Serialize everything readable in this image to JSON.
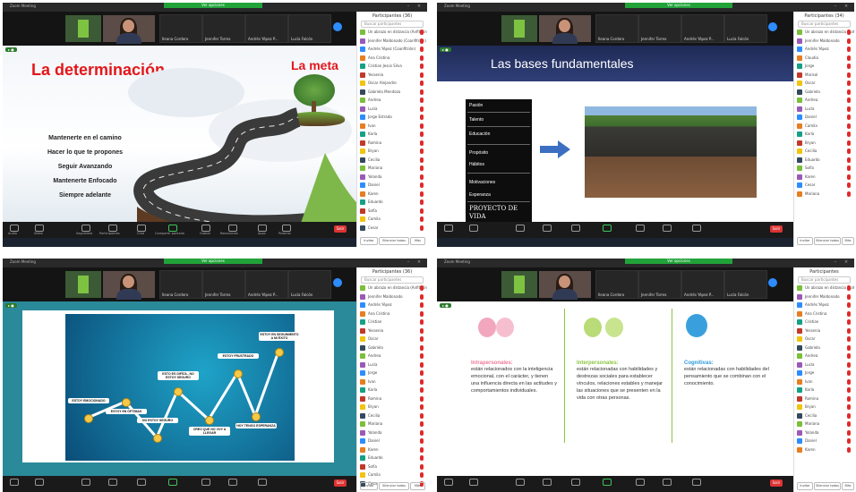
{
  "panes": [
    {
      "window_title": "Zoom Meeting",
      "participants_title": "Participantes (36)",
      "search_placeholder": "Buscar participantes",
      "participant_names": [
        "Un abrazo en distancia (Anfitrión, yo)",
        "Jennifer Maldonado (Coanfitrión)",
        "Andrés Yépez (Coanfitrión)",
        "Ana Cristina",
        "Cristian Jesús Silva",
        "Yessenia",
        "Oscar Alejandro",
        "Gabriela Mendoza",
        "Andrea",
        "Lucía",
        "Jorge Estrada",
        "Ivan",
        "Karla",
        "Romina",
        "Bryan",
        "Cecilia",
        "Mariana",
        "Yolanda",
        "Daniel",
        "Karen",
        "Eduardo",
        "Sofía",
        "Camila",
        "Cesar"
      ],
      "footer_buttons": [
        "Invitar",
        "Silenciar todos",
        "Más"
      ],
      "slide": {
        "title": "La determinación",
        "goal_label": "La meta",
        "items": [
          "Mantenerte en el camino",
          "Hacer lo que te propones",
          "Seguir Avanzando",
          "Mantenerte Enfocado",
          "Siempre adelante"
        ]
      }
    },
    {
      "window_title": "Zoom Meeting",
      "participants_title": "Participantes (34)",
      "search_placeholder": "Buscar participantes",
      "participant_names": [
        "Un abrazo en distancia (Anfitrión, yo)",
        "Jennifer Maldonado",
        "Andrés Yépez",
        "Claudia",
        "Jorge",
        "Marisol",
        "Oscar",
        "Gabriela",
        "Andrea",
        "Lucía",
        "Daniel",
        "Camila",
        "Karla",
        "Bryan",
        "Cecilia",
        "Eduardo",
        "Sofía",
        "Karen",
        "Cesar",
        "Mariana"
      ],
      "footer_buttons": [
        "Invitar",
        "Silenciar todos",
        "Más"
      ],
      "slide": {
        "title": "Las bases fundamentales",
        "bases": [
          "Pasión",
          "Talento",
          "Educación",
          "Propósito",
          "Hábitos",
          "Motivaciones",
          "Esperanza"
        ],
        "footer": "PROYECTO DE VIDA"
      }
    },
    {
      "window_title": "Zoom Meeting",
      "participants_title": "Participantes (36)",
      "search_placeholder": "Buscar participantes",
      "participant_names": [
        "Un abrazo en distancia (Anfitrión, yo)",
        "Jennifer Maldonado",
        "Andrés Yépez",
        "Ana Cristina",
        "Cristian",
        "Yessenia",
        "Oscar",
        "Gabriela",
        "Andrea",
        "Lucía",
        "Jorge",
        "Ivan",
        "Karla",
        "Romina",
        "Bryan",
        "Cecilia",
        "Mariana",
        "Yolanda",
        "Daniel",
        "Karen",
        "Eduardo",
        "Sofía",
        "Camila",
        "Cesar"
      ],
      "footer_buttons": [
        "Invitar",
        "Silenciar todos",
        "Más"
      ],
      "slide": {
        "nodes": [
          "ESTOY EMOCIONADO",
          "ESTOY EN ÓPTIMAS",
          "NO ESTOY SEGURO",
          "ESTO ES DIFÍCIL, NO ESTOY SEGURO",
          "ESTOY FRUSTRADO",
          "CREO QUE NO VOY A LLEGAR",
          "HOY TENGO ESPERANZA",
          "HOY ALGO SALE BIEN",
          "ESTOY EN SEGUIMIENTO A MI ÉXITO"
        ]
      }
    },
    {
      "window_title": "Zoom Meeting",
      "participants_title": "Participantes",
      "search_placeholder": "Buscar participantes",
      "participant_names": [
        "Un abrazo en distancia (Anfitrión, yo)",
        "Jennifer Maldonado",
        "Andrés Yépez",
        "Ana Cristina",
        "Cristian",
        "Yessenia",
        "Oscar",
        "Gabriela",
        "Andrea",
        "Lucía",
        "Jorge",
        "Ivan",
        "Karla",
        "Romina",
        "Bryan",
        "Cecilia",
        "Mariana",
        "Yolanda",
        "Daniel",
        "Karen"
      ],
      "footer_buttons": [
        "Invitar",
        "Silenciar todos",
        "Más"
      ],
      "slide": {
        "columns": [
          {
            "title": "Intrapersonales:",
            "body": "están relacionados con la inteligencia emocional, con el carácter, y tienen una influencia directa en las actitudes y comportamientos individuales.",
            "color": "#ef7a9a"
          },
          {
            "title": "Interpersonales:",
            "body": "están relacionadas con habilidades y destrezas sociales para establecer vínculos, relaciones estables y manejar las situaciones que se presenten en la vida con otras personas.",
            "color": "#8cc63f"
          },
          {
            "title": "Cognitivas:",
            "body": "están relacionadas con habilidades del pensamiento que se combinan con el conocimiento.",
            "color": "#2d9ad8"
          }
        ]
      }
    }
  ],
  "meeting": {
    "speaker_tiles": [
      "Ileana Cordero",
      "Jennifer Torres",
      "Andrés Yépez P...",
      "Lucía Falcón"
    ],
    "recording_label": "Estás viendo la pantalla de Un abrazo en distancia",
    "toolbar_labels": [
      "Audio",
      "Video",
      "Seguridad",
      "Participantes",
      "Chat",
      "Compartir pantalla",
      "Grabar",
      "Reacciones",
      "Apps",
      "Pizarras"
    ],
    "end_label": "Salir",
    "view_label": "Ver opciones"
  }
}
